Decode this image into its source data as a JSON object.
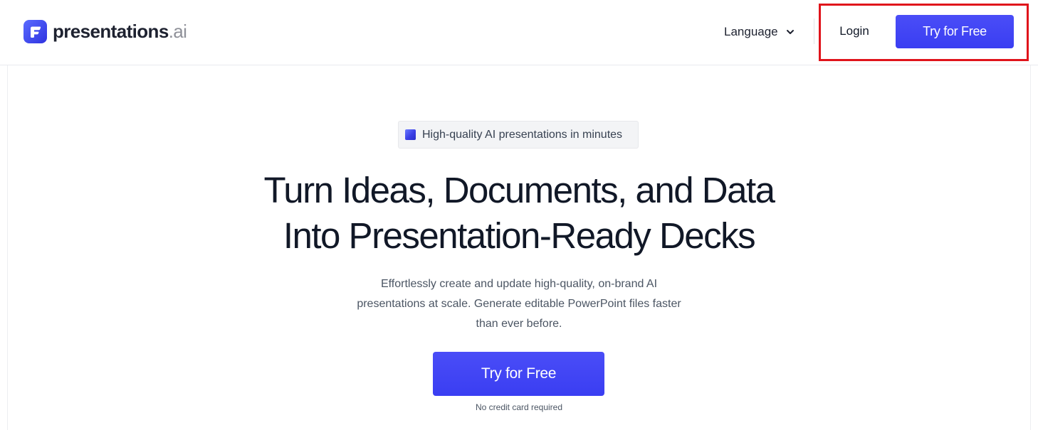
{
  "header": {
    "logo": {
      "name": "presentations",
      "suffix": ".ai",
      "icon": "presentations-logo-icon"
    },
    "language": {
      "label": "Language",
      "icon": "chevron-down-icon"
    },
    "login_label": "Login",
    "cta_label": "Try for Free"
  },
  "hero": {
    "badge_text": "High-quality AI presentations in minutes",
    "headline_lines": [
      "Turn Ideas, Documents, and Data",
      "Into Presentation-Ready Decks"
    ],
    "subtext_lines": [
      "Effortlessly create and update high-quality, on-brand AI",
      "presentations at scale. Generate editable PowerPoint files faster",
      "than ever before."
    ],
    "cta_label": "Try for Free",
    "note": "No credit card required"
  },
  "colors": {
    "accent": "#3b3ff4",
    "highlight_box": "#e0141b",
    "text_dark": "#111827",
    "text_muted": "#4b5563"
  }
}
